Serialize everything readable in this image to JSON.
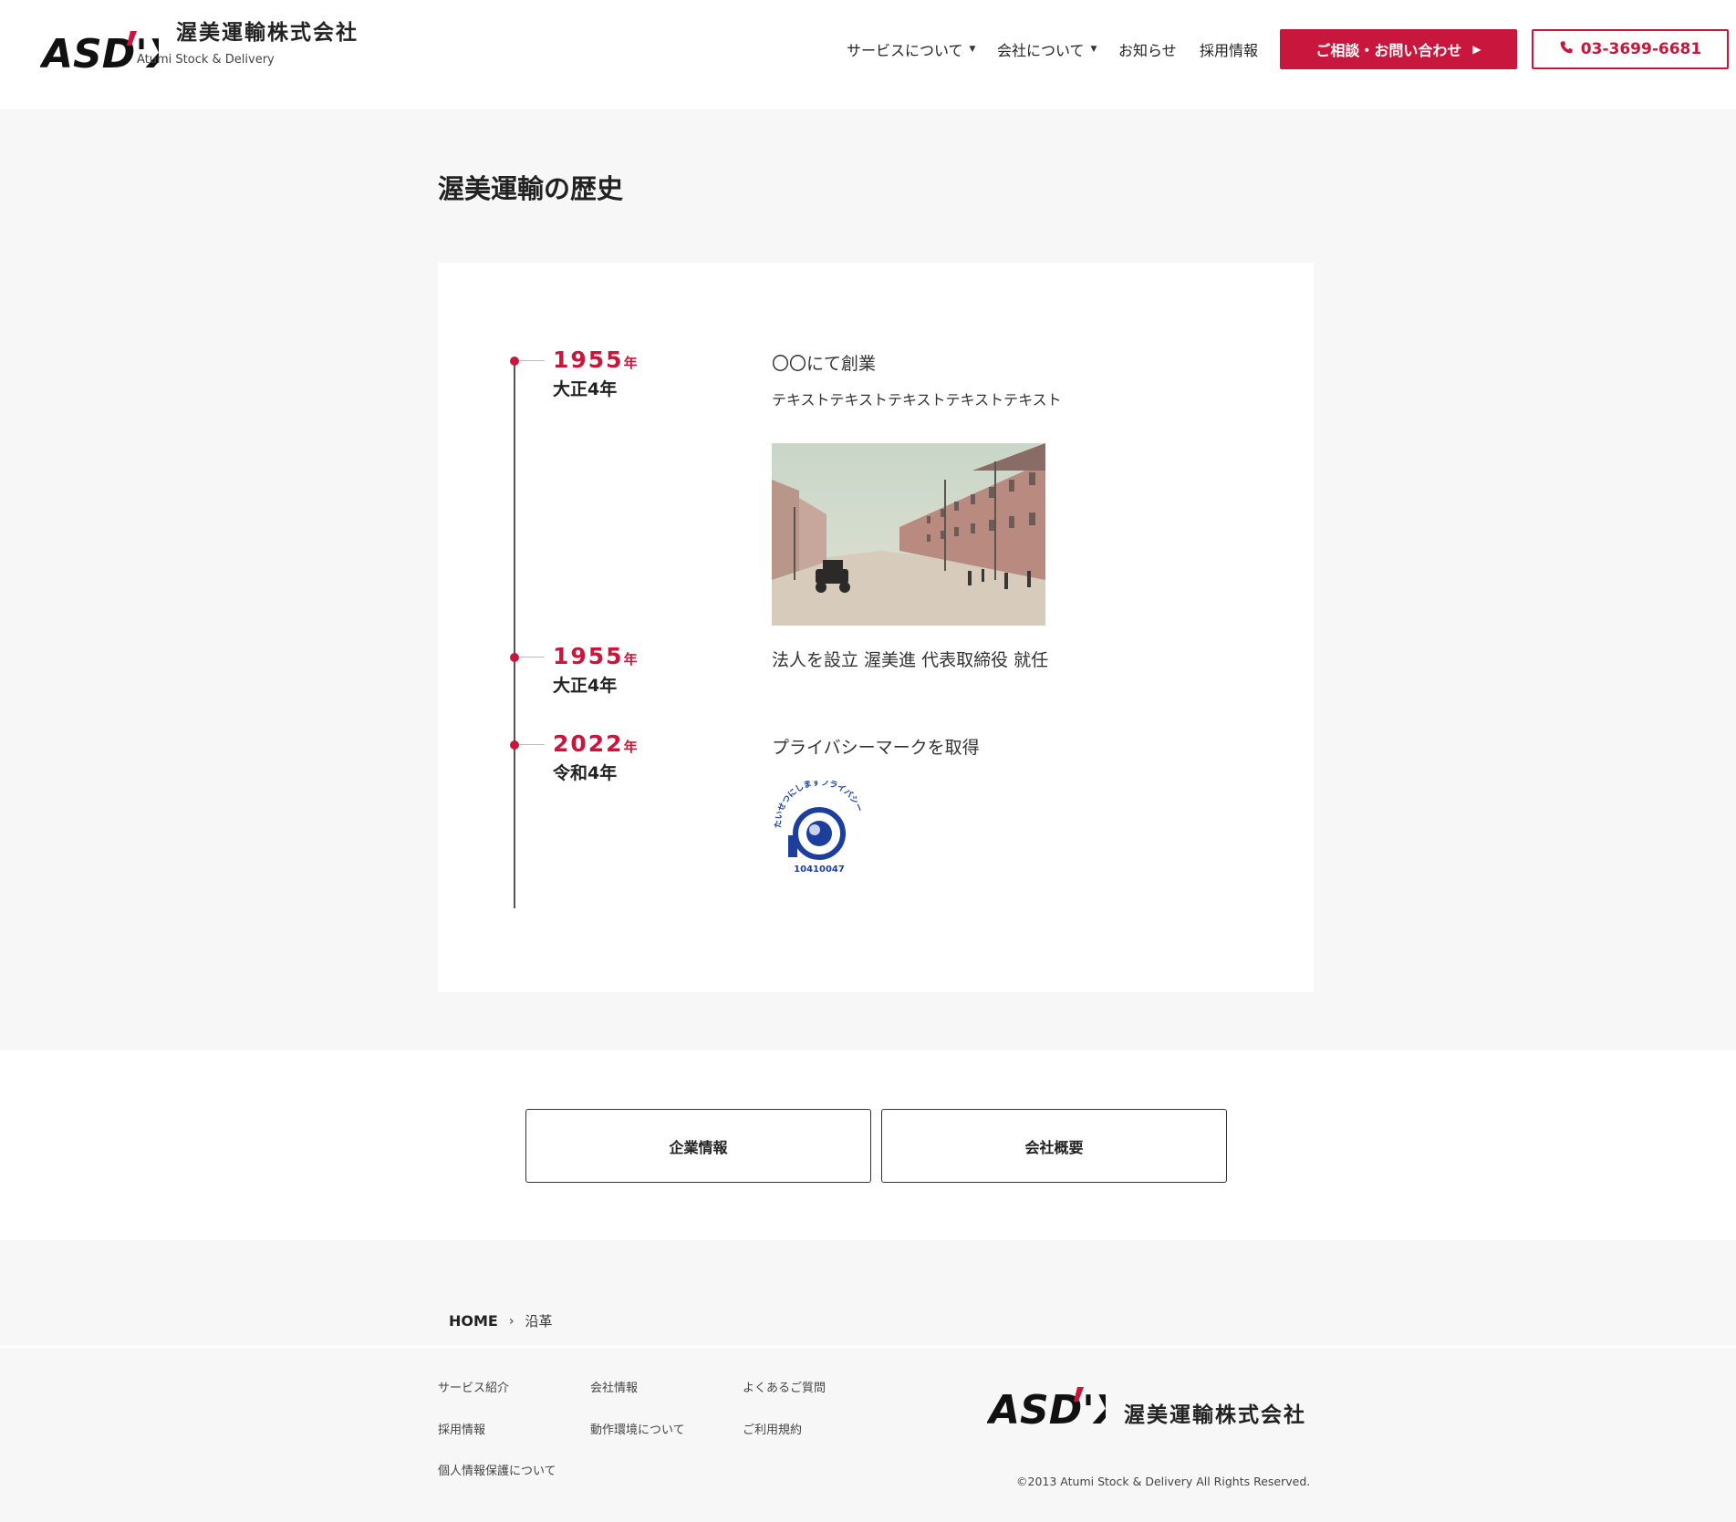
{
  "header": {
    "logo_text": "ASD'X",
    "company_name": "渥美運輸株式会社",
    "company_sub": "Atumi Stock & Delivery",
    "nav": [
      {
        "label": "サービスについて",
        "has_dropdown": true
      },
      {
        "label": "会社について",
        "has_dropdown": true
      },
      {
        "label": "お知らせ",
        "has_dropdown": false
      },
      {
        "label": "採用情報",
        "has_dropdown": false
      }
    ],
    "contact_label": "ご相談・お問い合わせ",
    "phone_label": "03-3699-6681",
    "accent_color": "#c8163c"
  },
  "history": {
    "title": "渥美運輸の歴史",
    "entries": [
      {
        "year": "1955",
        "year_suffix": "年",
        "era": "大正4年",
        "title": "〇〇にて創業",
        "text": "テキストテキストテキストテキストテキスト",
        "image": "historic-street-photo"
      },
      {
        "year": "1955",
        "year_suffix": "年",
        "era": "大正4年",
        "title": "法人を設立 渥美進 代表取締役 就任"
      },
      {
        "year": "2022",
        "year_suffix": "年",
        "era": "令和4年",
        "title": "プライバシーマークを取得",
        "image": "privacy-mark",
        "mark_arc": "たいせつにしますプライバシー",
        "mark_number": "10410047"
      }
    ]
  },
  "links": {
    "corporate_info": "企業情報",
    "company_overview": "会社概要"
  },
  "footer": {
    "breadcrumb": {
      "home": "HOME",
      "current": "沿革"
    },
    "links": [
      "サービス紹介",
      "会社情報",
      "よくあるご質問",
      "採用情報",
      "動作環境について",
      "ご利用規約",
      "個人情報保護について"
    ],
    "company_name": "渥美運輸株式会社",
    "copyright": "©2013 Atumi Stock & Delivery All Rights Reserved."
  }
}
